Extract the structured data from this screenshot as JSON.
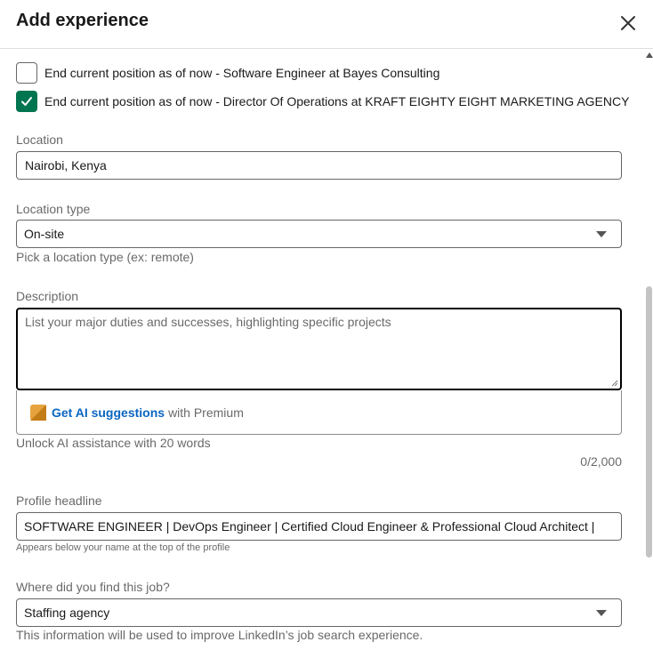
{
  "header": {
    "title": "Add experience"
  },
  "checkboxes": [
    {
      "label": "End current position as of now - Software Engineer at Bayes Consulting",
      "checked": false
    },
    {
      "label": "End current position as of now - Director Of Operations at KRAFT EIGHTY EIGHT MARKETING AGENCY",
      "checked": true
    }
  ],
  "location": {
    "label": "Location",
    "value": "Nairobi, Kenya"
  },
  "location_type": {
    "label": "Location type",
    "value": "On-site",
    "helper": "Pick a location type (ex: remote)"
  },
  "description": {
    "label": "Description",
    "placeholder": "List your major duties and successes, highlighting specific projects",
    "ai_link": "Get AI suggestions",
    "ai_suffix": "with Premium",
    "ai_helper": "Unlock AI assistance with 20 words",
    "counter": "0/2,000"
  },
  "headline": {
    "label": "Profile headline",
    "value": "SOFTWARE ENGINEER | DevOps Engineer | Certified Cloud Engineer & Professional Cloud Architect |",
    "helper": "Appears below your name at the top of the profile"
  },
  "job_source": {
    "label": "Where did you find this job?",
    "value": "Staffing agency",
    "helper": "This information will be used to improve LinkedIn’s job search experience."
  },
  "colors": {
    "checked_green": "#01754f",
    "link_blue": "#0a66c2"
  },
  "icons": {
    "close": "close-icon",
    "check": "checkmark-icon",
    "caret": "chevron-down-icon",
    "premium": "premium-badge-icon"
  }
}
